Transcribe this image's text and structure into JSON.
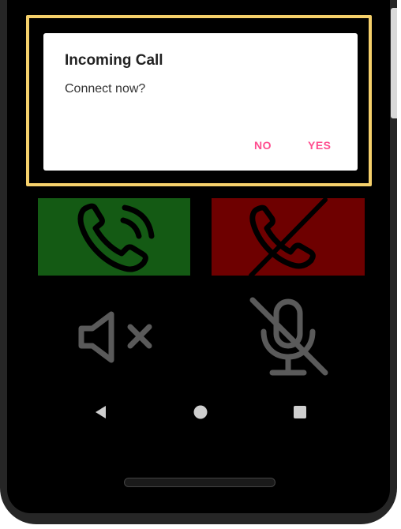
{
  "dialog": {
    "title": "Incoming Call",
    "message": "Connect now?",
    "no_label": "NO",
    "yes_label": "YES"
  },
  "colors": {
    "accent": "#ff4d8f",
    "answer_bg": "#145a14",
    "decline_bg": "#6e0000",
    "highlight": "#f5d06b"
  },
  "icons": {
    "answer": "phone-ringing-icon",
    "decline": "phone-off-icon",
    "speaker": "speaker-mute-icon",
    "mic": "mic-off-icon",
    "back": "back-triangle-icon",
    "home": "home-circle-icon",
    "recents": "recents-square-icon"
  }
}
